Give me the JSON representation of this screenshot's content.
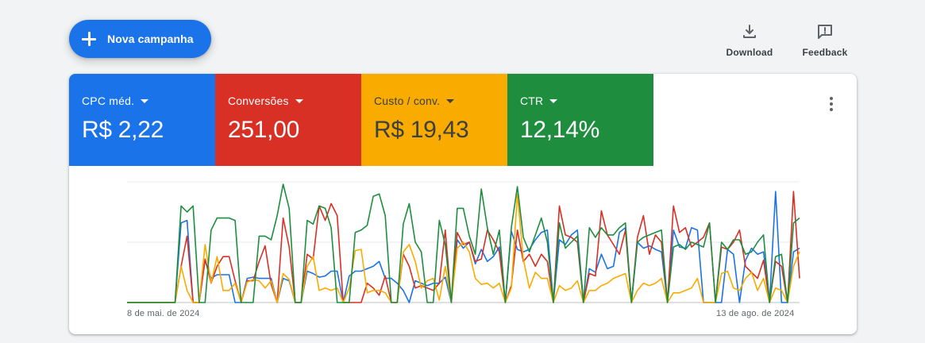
{
  "toolbar": {
    "new_campaign_label": "Nova campanha",
    "download_label": "Download",
    "feedback_label": "Feedback"
  },
  "metrics": [
    {
      "label": "CPC méd.",
      "value": "R$ 2,22",
      "color": "#1a73e8"
    },
    {
      "label": "Conversões",
      "value": "251,00",
      "color": "#d93025"
    },
    {
      "label": "Custo / conv.",
      "value": "R$ 19,43",
      "color": "#f9ab00"
    },
    {
      "label": "CTR",
      "value": "12,14%",
      "color": "#1e8e3e"
    }
  ],
  "chart_data": {
    "type": "line",
    "x_start_label": "8 de mai. de 2024",
    "x_end_label": "13 de ago. de 2024",
    "grid": true,
    "ylim": [
      0,
      1
    ],
    "series": [
      {
        "name": "CPC méd.",
        "color": "#1a73e8",
        "values": [
          0,
          0,
          0,
          0,
          0,
          0,
          0,
          0,
          0,
          0.66,
          0.68,
          0,
          0,
          0.35,
          0.2,
          0.23,
          0.23,
          0.23,
          0,
          0,
          0.2,
          0.21,
          0.2,
          0.2,
          0.2,
          0,
          0.2,
          0.18,
          0,
          0,
          0.26,
          0.24,
          0.21,
          0.22,
          0.26,
          0.26,
          0,
          0.22,
          0.26,
          0.26,
          0.28,
          0.3,
          0.34,
          0.2,
          0.2,
          0.16,
          0.1,
          0,
          0.18,
          0.16,
          0.14,
          0.16,
          0.16,
          0.21,
          0,
          0.52,
          0.45,
          0.5,
          0.32,
          0.44,
          0.34,
          0.38,
          0.46,
          0,
          0.59,
          0.44,
          0.42,
          0.44,
          0.52,
          0.58,
          0.6,
          0,
          0.52,
          0.48,
          0.56,
          0.6,
          0,
          0.28,
          0.25,
          0.4,
          0.28,
          0.3,
          0.58,
          0.62,
          0,
          0.5,
          0.45,
          0.47,
          0.44,
          0.42,
          0,
          0.6,
          0.46,
          0.45,
          0.62,
          0.6,
          0,
          0,
          0,
          0,
          0.44,
          0.4,
          0,
          0.35,
          0.45,
          0.4,
          0.42,
          0,
          0.92,
          0,
          0,
          0.42,
          0.45
        ]
      },
      {
        "name": "Conversões",
        "color": "#d93025",
        "values": [
          0,
          0,
          0,
          0,
          0,
          0,
          0,
          0,
          0,
          0.3,
          0.55,
          0,
          0,
          0.36,
          0.16,
          0.3,
          0.38,
          0.38,
          0.18,
          0,
          0.18,
          0.18,
          0.34,
          0.47,
          0.15,
          0,
          0.7,
          0.46,
          0,
          0,
          0.4,
          0.36,
          0.8,
          0.68,
          0.82,
          0.72,
          0,
          0,
          0,
          0,
          0.16,
          0.12,
          0.06,
          0.22,
          0,
          0,
          0.4,
          0.3,
          0.12,
          0.14,
          0.12,
          0.1,
          0.16,
          0.6,
          0,
          0.58,
          0.48,
          0.5,
          0.34,
          0.36,
          0.6,
          0.52,
          0.42,
          0,
          0.14,
          0.6,
          0.34,
          0.4,
          0.3,
          0.4,
          0.34,
          0,
          0.8,
          0.56,
          0.54,
          0.5,
          0,
          0.24,
          0.22,
          0.76,
          0.56,
          0.48,
          0.4,
          0.6,
          0,
          0.54,
          0.72,
          0.4,
          0.56,
          0.5,
          0,
          0.8,
          0.58,
          0.62,
          0.46,
          0.5,
          0.54,
          0.66,
          0,
          0.46,
          0.44,
          0.5,
          0.6,
          0.3,
          0.25,
          0.2,
          0.35,
          0,
          0.34,
          0.3,
          0,
          0.92,
          0.2
        ]
      },
      {
        "name": "Custo / conv.",
        "color": "#f9ab00",
        "values": [
          0,
          0,
          0,
          0,
          0,
          0,
          0,
          0,
          0,
          0.3,
          0.1,
          0,
          0,
          0.48,
          0.16,
          0.38,
          0.1,
          0.1,
          0.16,
          0,
          0.17,
          0.19,
          0.18,
          0.12,
          0.18,
          0,
          0.24,
          0.19,
          0,
          0,
          0.3,
          0.38,
          0.1,
          0.12,
          0.1,
          0.12,
          0,
          0.12,
          0.43,
          0.44,
          0.08,
          0.1,
          0.1,
          0.08,
          0,
          0,
          0.42,
          0.48,
          0.34,
          0.12,
          0.18,
          0.2,
          0.02,
          0.3,
          0,
          0.45,
          0.5,
          0.42,
          0.2,
          0.15,
          0.16,
          0.12,
          0.16,
          0,
          0.12,
          0.9,
          0.36,
          0.12,
          0.25,
          0.2,
          0.2,
          0,
          0.14,
          0.1,
          0.12,
          0.18,
          0,
          0.1,
          0.1,
          0.14,
          0.16,
          0.2,
          0.22,
          0.24,
          0,
          0.1,
          0.16,
          0.14,
          0.16,
          0.2,
          0,
          0.08,
          0.08,
          0.1,
          0.12,
          0.2,
          0,
          0,
          0,
          0.24,
          0.26,
          0.12,
          0.1,
          0.2,
          0.25,
          0.1,
          0.2,
          0,
          0.12,
          0.1,
          0,
          0.3,
          0.42
        ]
      },
      {
        "name": "CTR",
        "color": "#1e8e3e",
        "values": [
          0,
          0,
          0,
          0,
          0,
          0,
          0,
          0,
          0,
          0.8,
          0.75,
          0.8,
          0,
          0,
          0.6,
          0.7,
          0.7,
          0.7,
          0.68,
          0,
          0,
          0,
          0.55,
          0.55,
          0.52,
          0.72,
          0.98,
          0.78,
          0,
          0,
          0.68,
          0.65,
          0.8,
          0.78,
          0.62,
          0,
          0,
          0,
          0.58,
          0.6,
          0.64,
          0.88,
          0.9,
          0.72,
          0,
          0,
          0.65,
          0.82,
          0.5,
          0.42,
          0,
          0,
          0.68,
          0.48,
          0,
          0.78,
          0.78,
          0.55,
          0.4,
          0.94,
          0.62,
          0.4,
          0.6,
          0,
          0.62,
          0.96,
          0.54,
          0.42,
          0.56,
          0.7,
          0.5,
          0,
          0.66,
          0.45,
          0.5,
          0.55,
          0,
          0.62,
          0.54,
          0.62,
          0.56,
          0.56,
          0.62,
          0.66,
          0,
          0.5,
          0.54,
          0.56,
          0.58,
          0.6,
          0,
          0.46,
          0.48,
          0.44,
          0.5,
          0.48,
          0.46,
          0.66,
          0,
          0.5,
          0.44,
          0.52,
          0.52,
          0.4,
          0.42,
          0.5,
          0.56,
          0,
          0.38,
          0.4,
          0,
          0.66,
          0.7
        ]
      }
    ]
  }
}
